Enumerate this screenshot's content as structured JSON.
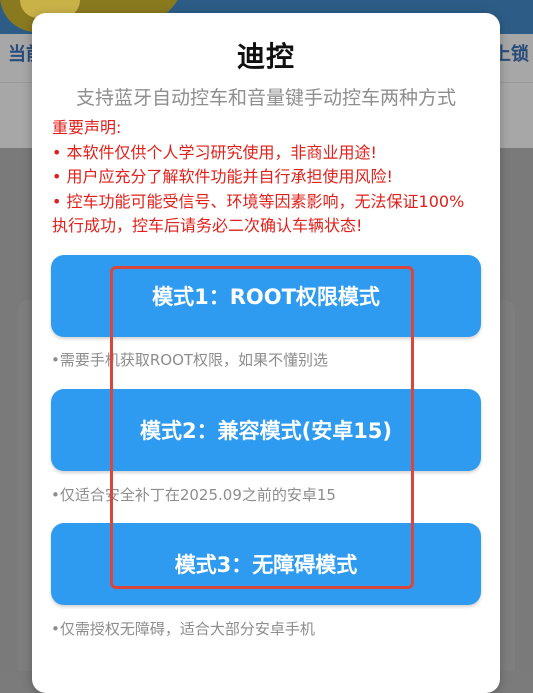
{
  "background": {
    "left_text": "当前",
    "right_text": "上锁"
  },
  "dialog": {
    "title": "迪控",
    "subtitle": "支持蓝牙自动控车和音量键手动控车两种方式",
    "disclaimer": [
      "重要声明:",
      "• 本软件仅供个人学习研究使用，非商业用途!",
      "• 用户应充分了解软件功能并自行承担使用风险!",
      "• 控车功能可能受信号、环境等因素影响，无法保证100%",
      "执行成功，控车后请务必二次确认车辆状态!"
    ],
    "modes": [
      {
        "label": "模式1：ROOT权限模式",
        "note": "•需要手机获取ROOT权限，如果不懂别选"
      },
      {
        "label": "模式2：兼容模式(安卓15)",
        "note": "•仅适合安全补丁在2025.09之前的安卓15"
      },
      {
        "label": "模式3：无障碍模式",
        "note": "•仅需授权无障碍，适合大部分安卓手机"
      }
    ]
  },
  "colors": {
    "accent": "#2f9bf0",
    "warning": "#e0201b",
    "highlight": "#d9463c"
  }
}
